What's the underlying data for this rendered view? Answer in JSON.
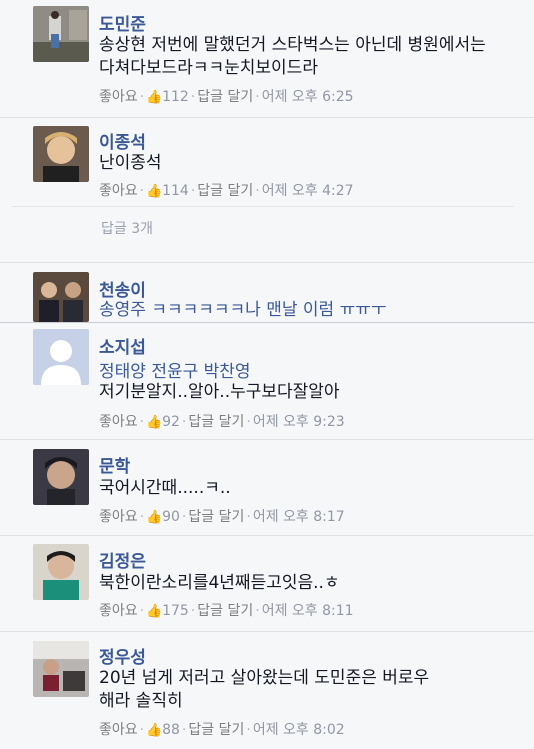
{
  "comments": [
    {
      "name": "도민준",
      "text": "송상현 저번에 말했던거 스타벅스는 아닌데 병원에서는 다쳐다보드라ㅋㅋ눈치보이드라",
      "like_label": "좋아요",
      "like_count": "112",
      "reply_label": "답글 달기",
      "time": "어제 오후 6:25"
    },
    {
      "name": "이종석",
      "text": "난이종석",
      "like_label": "좋아요",
      "like_count": "114",
      "reply_label": "답글 달기",
      "time": "어제 오후 4:27",
      "replies_link": "답글 3개"
    },
    {
      "name": "천송이",
      "text": "송영주 ㅋㅋㅋㅋㅋㅋ나 맨날 이럼 ㅠㅠㅜ"
    },
    {
      "name": "소지섭",
      "tags": "정태양 전윤구 박찬영",
      "text": "저기분알지..알아..누구보다잘알아",
      "like_label": "좋아요",
      "like_count": "92",
      "reply_label": "답글 달기",
      "time": "어제 오후 9:23"
    },
    {
      "name": "문학",
      "text": "국어시간때.....ㅋ..",
      "like_label": "좋아요",
      "like_count": "90",
      "reply_label": "답글 달기",
      "time": "어제 오후 8:17"
    },
    {
      "name": "김정은",
      "text": "북한이란소리를4년째듣고잇음..ㅎ",
      "like_label": "좋아요",
      "like_count": "175",
      "reply_label": "답글 달기",
      "time": "어제 오후 8:11"
    },
    {
      "name": "정우성",
      "text": "20년 넘게 저러고 살아왔는데 도민준은 버로우\n해라 솔직히",
      "like_label": "좋아요",
      "like_count": "88",
      "reply_label": "답글 달기",
      "time": "어제 오후 8:02"
    }
  ],
  "icons": {
    "like": "thumbs-up-icon"
  },
  "colors": {
    "name": "#3b5998",
    "text": "#141823",
    "meta": "#9197a3",
    "background": "#f6f7f9"
  }
}
